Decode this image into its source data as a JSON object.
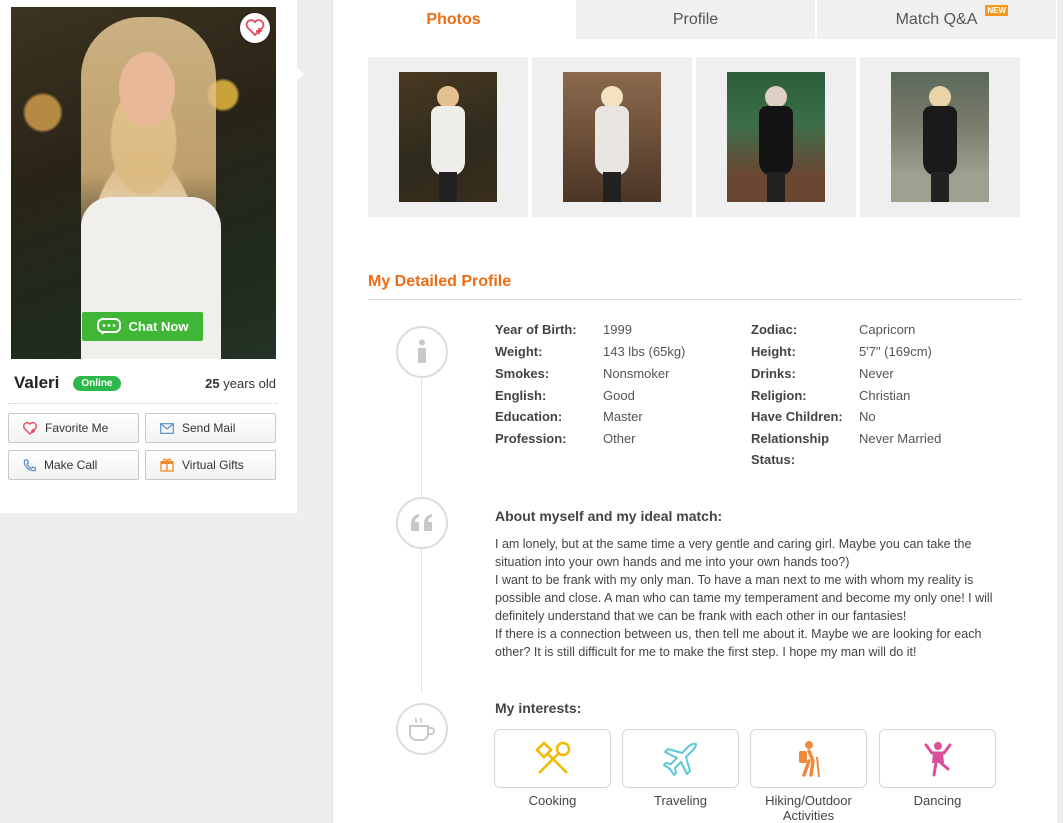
{
  "profile": {
    "name": "Valeri",
    "status": "Online",
    "age_number": "25",
    "age_suffix": "years old",
    "chat_label": "Chat Now"
  },
  "actions": {
    "favorite": "Favorite Me",
    "send_mail": "Send Mail",
    "make_call": "Make Call",
    "virtual_gifts": "Virtual Gifts"
  },
  "tabs": [
    {
      "label": "Photos"
    },
    {
      "label": "Profile"
    },
    {
      "label": "Match Q&A",
      "badge": "NEW"
    }
  ],
  "section_title": "My Detailed Profile",
  "details_left": [
    {
      "label": "Year of Birth:",
      "value": "1999"
    },
    {
      "label": "Weight:",
      "value": "143 lbs (65kg)"
    },
    {
      "label": "Smokes:",
      "value": "Nonsmoker"
    },
    {
      "label": "English:",
      "value": "Good"
    },
    {
      "label": "Education:",
      "value": "Master"
    },
    {
      "label": "Profession:",
      "value": "Other"
    }
  ],
  "details_right": [
    {
      "label": "Zodiac:",
      "value": "Capricorn"
    },
    {
      "label": "Height:",
      "value": "5'7\" (169cm)"
    },
    {
      "label": "Drinks:",
      "value": "Never"
    },
    {
      "label": "Religion:",
      "value": "Christian"
    },
    {
      "label": "Have Children:",
      "value": "No"
    },
    {
      "label": "Relationship",
      "label2": "Status:",
      "value": "Never Married"
    }
  ],
  "about": {
    "heading": "About myself and my ideal match:",
    "lines": [
      "I am lonely, but at the same time a very gentle and caring girl. Maybe you can take the",
      "situation into your own hands and me into your own hands too?)",
      "I want to be frank with my only man. To have a man next to me with whom my reality is",
      "possible and close. A man who can tame my temperament and become my only one! I will",
      "definitely understand that we can be frank with each other in our fantasies!",
      "If there is a connection between us, then tell me about it. Maybe we are looking for each",
      "other? It is still difficult for me to make the first step. I hope my man will do it!"
    ]
  },
  "interests": {
    "heading": "My interests:",
    "items": [
      {
        "label": "Cooking",
        "icon": "cooking-icon",
        "color": "#f2b800"
      },
      {
        "label": "Traveling",
        "icon": "airplane-icon",
        "color": "#5ec7d6"
      },
      {
        "label": "Hiking/Outdoor",
        "label2": "Activities",
        "icon": "hiker-icon",
        "color": "#f08a3c"
      },
      {
        "label": "Dancing",
        "icon": "dancer-icon",
        "color": "#d94f9a"
      }
    ]
  },
  "colors": {
    "accent": "#ee6c12",
    "online": "#2cb84a",
    "chat": "#3fb635"
  }
}
